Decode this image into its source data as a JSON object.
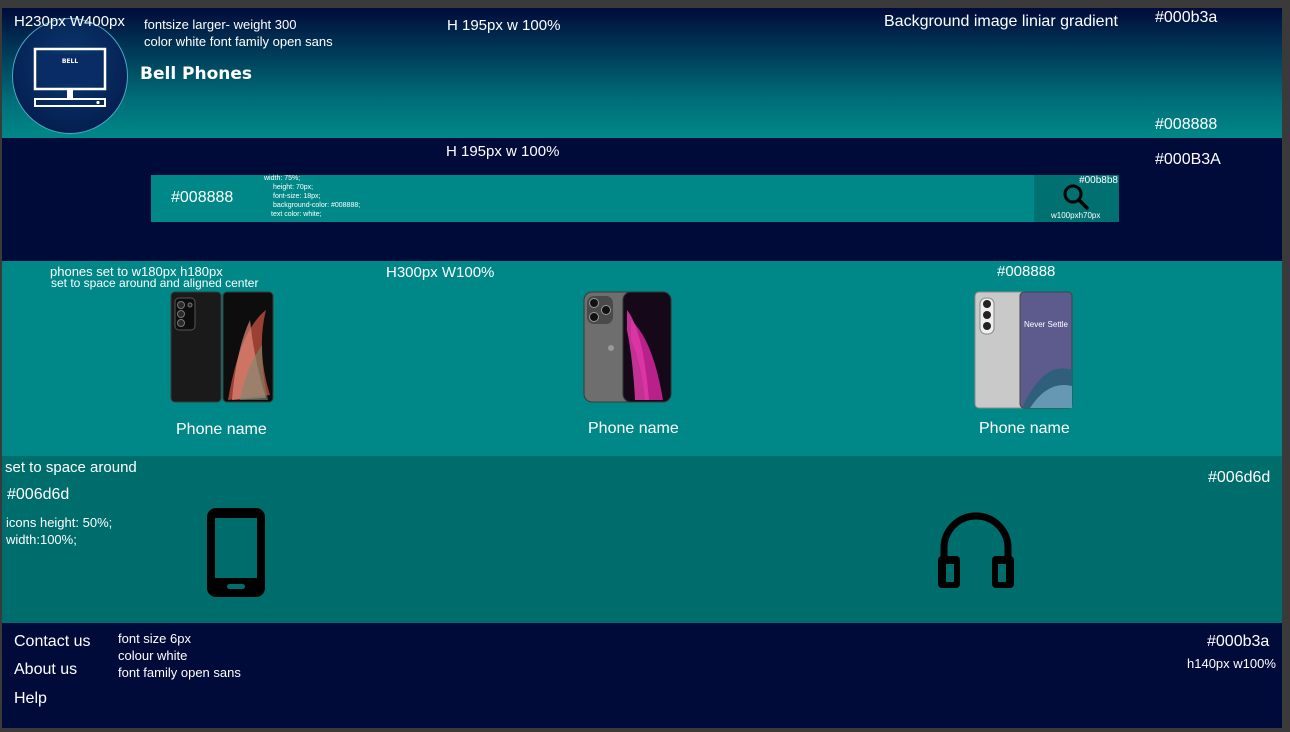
{
  "header": {
    "size_note": "H230px W400px",
    "font_note_1": "fontsize larger- weight 300",
    "font_note_2": "color white font family open sans",
    "brand": "Bell Phones",
    "logo_text": "BELL",
    "section_size_note": "H 195px w 100%",
    "bg_note": "Background image liniar gradient",
    "color_top": "#000b3a",
    "color_bottom": "#008888"
  },
  "search": {
    "section_size_note": "H 195px w 100%",
    "color_note": "#000B3A",
    "bar_color_note": "#008888",
    "css_lines": [
      "width: 75%;",
      "height: 70px;",
      "font-size: 18px;",
      "background-color: #008888;",
      "text color: white;"
    ],
    "button_color_note": "#00b8b8",
    "button_size_note": "w100pxh70px"
  },
  "phones": {
    "note_1": "phones set to w180px h180px",
    "note_2": "set to space around and aligned center",
    "size_note": "H300px W100%",
    "color_note": "#008888",
    "items": [
      {
        "name": "Phone name"
      },
      {
        "name": "Phone name"
      },
      {
        "name": "Phone name",
        "screen_text": "Never Settle"
      }
    ]
  },
  "icons": {
    "note_space": "set to space around",
    "color_note": "#006d6d",
    "color_note_right": "#006d6d",
    "size_note_1": "icons height: 50%;",
    "size_note_2": "width:100%;",
    "items": [
      {
        "icon": "smartphone-icon"
      },
      {
        "icon": "headphones-icon"
      }
    ]
  },
  "footer": {
    "links": [
      "Contact us",
      "About us",
      "Help"
    ],
    "note_1": "font size 6px",
    "note_2": "colour white",
    "note_3": "font family open sans",
    "color_note": "#000b3a",
    "size_note": "h140px w100%"
  }
}
